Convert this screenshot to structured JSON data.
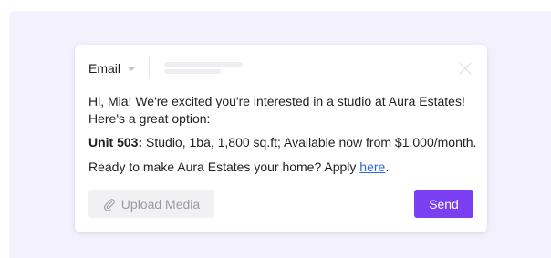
{
  "composer": {
    "channel": "Email",
    "message": {
      "greeting": "Hi, Mia! We're excited you're interested in a studio at Aura Estates! Here's a great option:",
      "unit_id": "Unit 503:",
      "unit_details": " Studio, 1ba, 1,800 sq.ft; Available now from $1,000/month.",
      "cta_text": "Ready to make Aura Estates your home? Apply ",
      "cta_link": "here",
      "cta_end": "."
    },
    "upload_label": "Upload Media",
    "send_label": "Send"
  },
  "colors": {
    "backdrop": "#f2f1fd",
    "accent": "#7b3ff2",
    "link": "#2a6ad9"
  },
  "icons": {
    "channel_dropdown": "chevron-down-icon",
    "close": "close-icon",
    "attachment": "paperclip-icon"
  }
}
